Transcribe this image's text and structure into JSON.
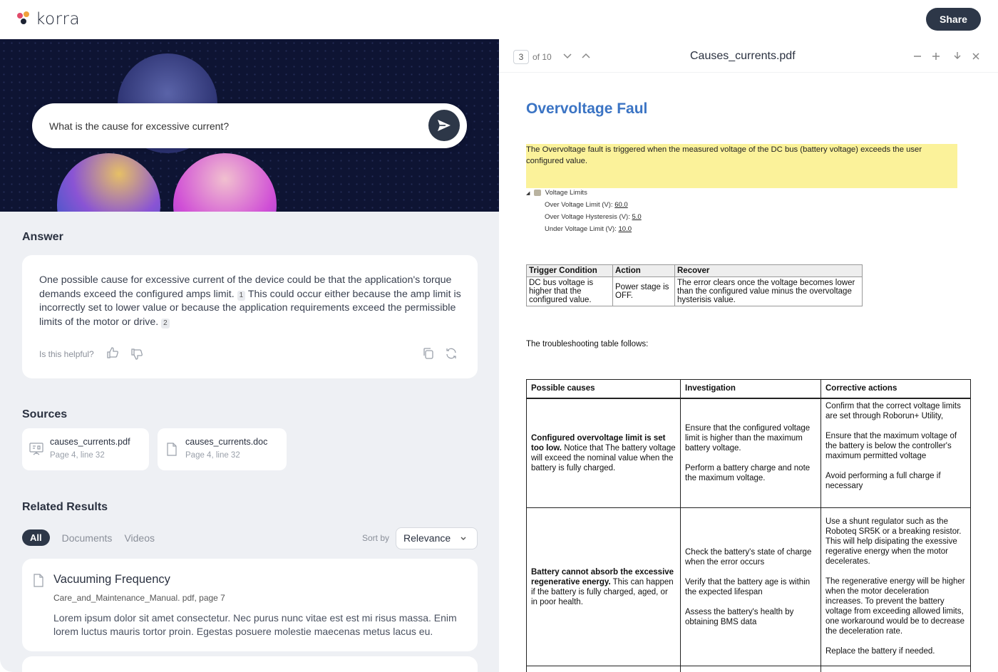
{
  "app": {
    "name": "korra",
    "share_label": "Share"
  },
  "search": {
    "value": "What is the cause for excessive current?"
  },
  "answer": {
    "title": "Answer",
    "text_1": "One possible cause for excessive current of the device could be that the application's torque demands exceed the configured amps limit.",
    "cite_1": "1",
    "text_2": "This could occur either because the amp limit is incorrectly set to lower value or because the application requirements exceed the permissible limits of the motor or drive.",
    "cite_2": "2",
    "helpful": "Is this helpful?"
  },
  "sources": {
    "title": "Sources",
    "items": [
      {
        "name": "causes_currents.pdf",
        "meta": "Page 4, line 32"
      },
      {
        "name": "causes_currents.doc",
        "meta": "Page 4, line 32"
      }
    ]
  },
  "related": {
    "title": "Related Results",
    "tabs": [
      "All",
      "Documents",
      "Videos"
    ],
    "sort_by_label": "Sort by",
    "sort_value": "Relevance",
    "results": [
      {
        "title": "Vacuuming Frequency",
        "meta": "Care_and_Maintenance_Manual. pdf, page 7",
        "snippet": "Lorem ipsum dolor sit amet consectetur. Nec purus nunc vitae est est mi risus massa. Enim lorem luctus mauris tortor proin. Egestas posuere molestie maecenas metus lacus eu."
      }
    ]
  },
  "viewer": {
    "page_current": "3",
    "page_total": "of 10",
    "file_name": "Causes_currents.pdf"
  },
  "document": {
    "heading": "Overvoltage Faul",
    "highlight": "The Overvoltage fault is triggered when the measured voltage of the DC bus (battery voltage) exceeds the user configured value.",
    "voltage_limits": {
      "title": "Voltage Limits",
      "over_label": "Over Voltage Limit (V):",
      "over_value": "60.0",
      "hyst_label": "Over Voltage Hysteresis (V):",
      "hyst_value": "5.0",
      "under_label": "Under Voltage Limit (V):",
      "under_value": "10.0"
    },
    "table1": {
      "headers": [
        "Trigger Condition",
        "Action",
        "Recover"
      ],
      "row": [
        "DC bus voltage is higher that the configured value.",
        "Power stage is OFF.",
        "The error clears once the voltage becomes lower than the configured value minus the overvoltage hysterisis value."
      ]
    },
    "follows": "The troubleshooting table follows:",
    "table2": {
      "headers": [
        "Possible causes",
        "Investigation",
        "Corrective actions"
      ],
      "r1_cause_bold": "Configured overvoltage limit is set too low.",
      "r1_cause": "Notice that The battery voltage will exceed the nominal value when the battery is fully charged.",
      "r1_inv_1": "Ensure that the configured voltage limit is higher than the maximum battery voltage.",
      "r1_inv_2": "Perform a battery charge and note the maximum voltage.",
      "r1_act_1": "Confirm that the correct voltage limits are set through Roborun+ Utility,",
      "r1_act_2": "Ensure that the maximum voltage of the battery is below the controller's maximum permitted voltage",
      "r1_act_3": "Avoid performing a full charge if necessary",
      "r2_cause_bold": "Battery cannot absorb the excessive regenerative energy.",
      "r2_cause": "This can happen if the battery is fully charged, aged, or in poor health.",
      "r2_inv_1": "Check the battery's state of charge when the error occurs",
      "r2_inv_2": "Verify that the battery age is within the expected lifespan",
      "r2_inv_3": "Assess the battery's health by obtaining BMS data",
      "r2_act_1": "Use a shunt regulator such as the Roboteq SR5K or a breaking resistor. This will help disipating the exessive regerative energy when the motor decelerates.",
      "r2_act_2": "The regenerative energy will be higher when the motor deceleration increases. To prevent the battery voltage from exceeding allowed limits, one workaround would be to decrease the deceleration rate.",
      "r2_act_3": "Replace the battery if needed."
    }
  },
  "colors": {
    "accent": "#2d3748",
    "link": "#3b74c4",
    "highlight": "#fbf29a"
  }
}
